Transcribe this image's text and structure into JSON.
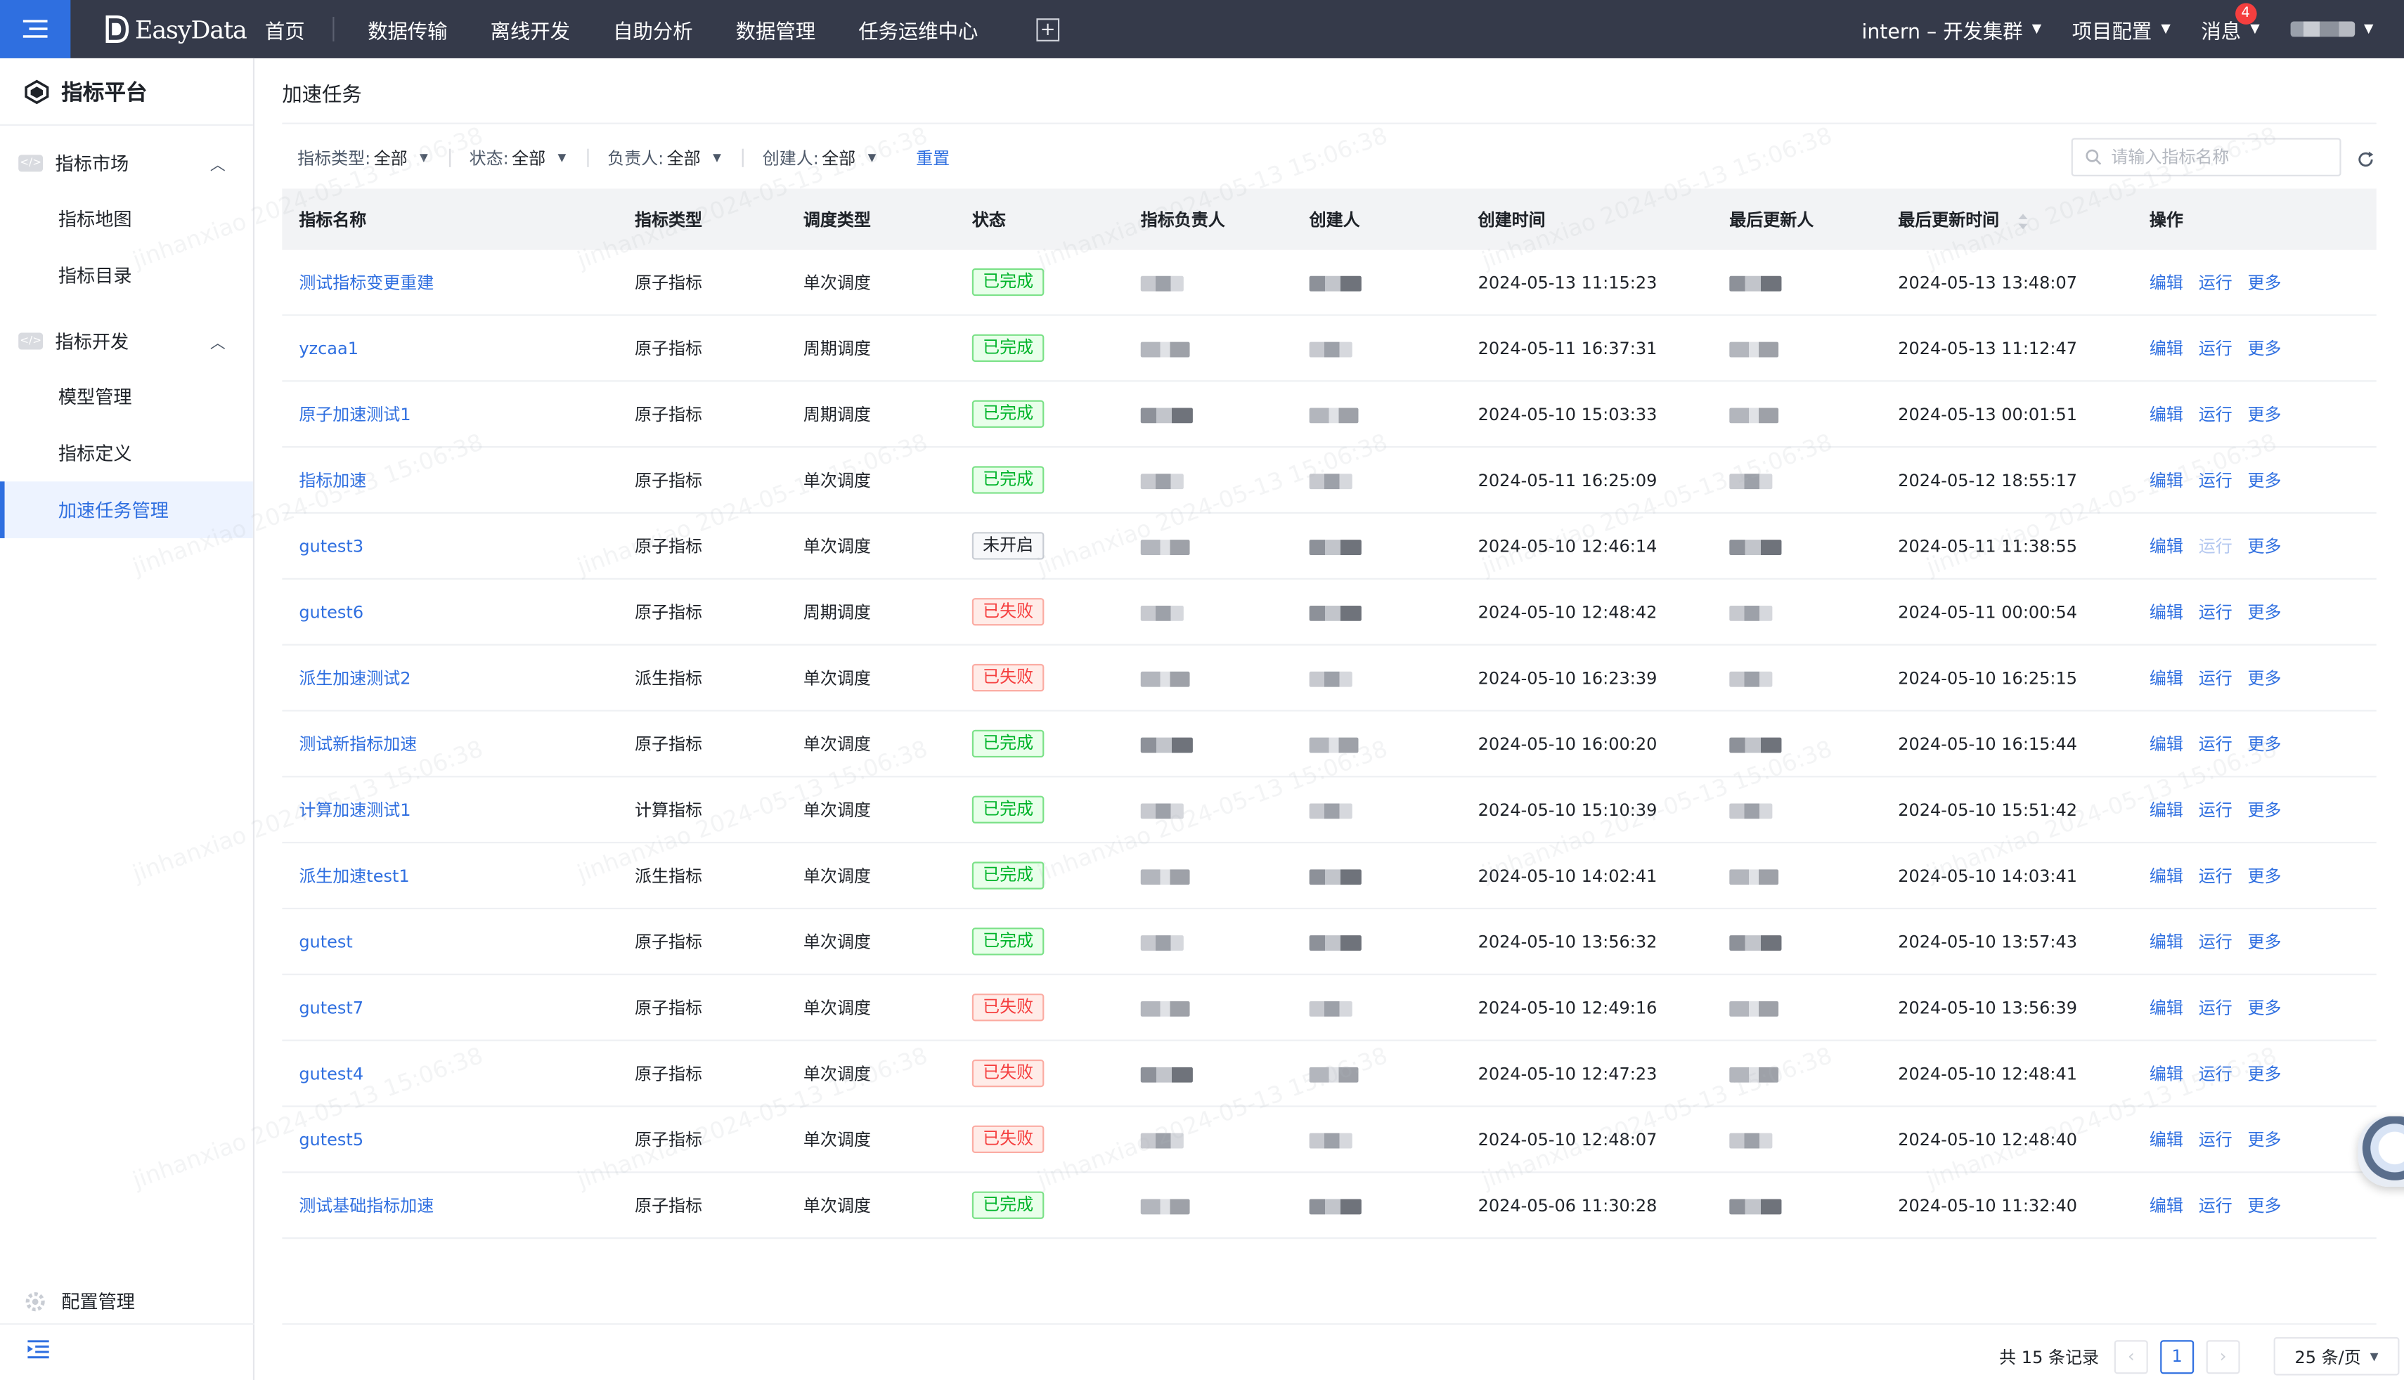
{
  "topnav": {
    "logo_text": "EasyData",
    "items": [
      "首页",
      "数据传输",
      "离线开发",
      "自助分析",
      "数据管理",
      "任务运维中心"
    ],
    "cluster": "intern – 开发集群",
    "project_config": "项目配置",
    "messages": "消息",
    "message_count": "4"
  },
  "sidebar": {
    "title": "指标平台",
    "groups": [
      {
        "label": "指标市场",
        "items": [
          "指标地图",
          "指标目录"
        ]
      },
      {
        "label": "指标开发",
        "items": [
          "模型管理",
          "指标定义",
          "加速任务管理"
        ]
      }
    ],
    "active_item": "加速任务管理",
    "config": "配置管理"
  },
  "page": {
    "title": "加速任务",
    "filters": [
      {
        "label": "指标类型:",
        "value": "全部"
      },
      {
        "label": "状态:",
        "value": "全部"
      },
      {
        "label": "负责人:",
        "value": "全部"
      },
      {
        "label": "创建人:",
        "value": "全部"
      }
    ],
    "reset": "重置",
    "search_placeholder": "请输入指标名称",
    "watermark": "jinhanxiao 2024-05-13 15:06:38"
  },
  "table": {
    "headers": [
      "指标名称",
      "指标类型",
      "调度类型",
      "状态",
      "指标负责人",
      "创建人",
      "创建时间",
      "最后更新人",
      "最后更新时间",
      "操作"
    ],
    "op_labels": {
      "edit": "编辑",
      "run": "运行",
      "more": "更多"
    },
    "rows": [
      {
        "name": "测试指标变更重建",
        "type": "原子指标",
        "schedule": "单次调度",
        "status": "已完成",
        "status_kind": "done",
        "created": "2024-05-13 11:15:23",
        "updated": "2024-05-13 13:48:07",
        "run_disabled": false
      },
      {
        "name": "yzcaa1",
        "type": "原子指标",
        "schedule": "周期调度",
        "status": "已完成",
        "status_kind": "done",
        "created": "2024-05-11 16:37:31",
        "updated": "2024-05-13 11:12:47",
        "run_disabled": false
      },
      {
        "name": "原子加速测试1",
        "type": "原子指标",
        "schedule": "周期调度",
        "status": "已完成",
        "status_kind": "done",
        "created": "2024-05-10 15:03:33",
        "updated": "2024-05-13 00:01:51",
        "run_disabled": false
      },
      {
        "name": "指标加速",
        "type": "原子指标",
        "schedule": "单次调度",
        "status": "已完成",
        "status_kind": "done",
        "created": "2024-05-11 16:25:09",
        "updated": "2024-05-12 18:55:17",
        "run_disabled": false
      },
      {
        "name": "gutest3",
        "type": "原子指标",
        "schedule": "单次调度",
        "status": "未开启",
        "status_kind": "idle",
        "created": "2024-05-10 12:46:14",
        "updated": "2024-05-11 11:38:55",
        "run_disabled": true
      },
      {
        "name": "gutest6",
        "type": "原子指标",
        "schedule": "周期调度",
        "status": "已失败",
        "status_kind": "fail",
        "created": "2024-05-10 12:48:42",
        "updated": "2024-05-11 00:00:54",
        "run_disabled": false
      },
      {
        "name": "派生加速测试2",
        "type": "派生指标",
        "schedule": "单次调度",
        "status": "已失败",
        "status_kind": "fail",
        "created": "2024-05-10 16:23:39",
        "updated": "2024-05-10 16:25:15",
        "run_disabled": false
      },
      {
        "name": "测试新指标加速",
        "type": "原子指标",
        "schedule": "单次调度",
        "status": "已完成",
        "status_kind": "done",
        "created": "2024-05-10 16:00:20",
        "updated": "2024-05-10 16:15:44",
        "run_disabled": false
      },
      {
        "name": "计算加速测试1",
        "type": "计算指标",
        "schedule": "单次调度",
        "status": "已完成",
        "status_kind": "done",
        "created": "2024-05-10 15:10:39",
        "updated": "2024-05-10 15:51:42",
        "run_disabled": false
      },
      {
        "name": "派生加速test1",
        "type": "派生指标",
        "schedule": "单次调度",
        "status": "已完成",
        "status_kind": "done",
        "created": "2024-05-10 14:02:41",
        "updated": "2024-05-10 14:03:41",
        "run_disabled": false
      },
      {
        "name": "gutest",
        "type": "原子指标",
        "schedule": "单次调度",
        "status": "已完成",
        "status_kind": "done",
        "created": "2024-05-10 13:56:32",
        "updated": "2024-05-10 13:57:43",
        "run_disabled": false
      },
      {
        "name": "gutest7",
        "type": "原子指标",
        "schedule": "单次调度",
        "status": "已失败",
        "status_kind": "fail",
        "created": "2024-05-10 12:49:16",
        "updated": "2024-05-10 13:56:39",
        "run_disabled": false
      },
      {
        "name": "gutest4",
        "type": "原子指标",
        "schedule": "单次调度",
        "status": "已失败",
        "status_kind": "fail",
        "created": "2024-05-10 12:47:23",
        "updated": "2024-05-10 12:48:41",
        "run_disabled": false
      },
      {
        "name": "gutest5",
        "type": "原子指标",
        "schedule": "单次调度",
        "status": "已失败",
        "status_kind": "fail",
        "created": "2024-05-10 12:48:07",
        "updated": "2024-05-10 12:48:40",
        "run_disabled": false
      },
      {
        "name": "测试基础指标加速",
        "type": "原子指标",
        "schedule": "单次调度",
        "status": "已完成",
        "status_kind": "done",
        "created": "2024-05-06 11:30:28",
        "updated": "2024-05-10 11:32:40",
        "run_disabled": false
      }
    ]
  },
  "pager": {
    "total": "共 15 条记录",
    "current_page": "1",
    "page_size": "25 条/页"
  },
  "colors": {
    "primary": "#2f6fe0",
    "nav_bg": "#353a4a",
    "success": "#00b42a",
    "danger": "#f53f3f"
  }
}
